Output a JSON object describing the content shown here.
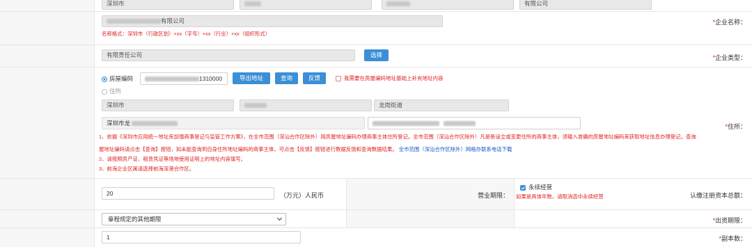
{
  "top_row": {
    "field1": "深圳市",
    "field4": "有限公司"
  },
  "company_name": {
    "label_req": "*",
    "label": "企业名称：",
    "value_suffix": "有限公司",
    "hint": "名称格式：深圳市（行政区划）+xx（字号）+xx（行业）+xx（组织形式）"
  },
  "company_type": {
    "label_req": "*",
    "label": "企业类型：",
    "value": "有限责任公司",
    "select_button": "选择"
  },
  "address": {
    "label_req": "*",
    "label": "住所：",
    "radio_house_code": "房屋编码",
    "house_code_value": "1310000",
    "btn_export": "导出地址",
    "btn_query": "查询",
    "btn_feedback": "反馈",
    "supplement_checkbox": "我需要在房屋编码地址基础上补充地址内容",
    "radio_residence": "住所",
    "city": "深圳市",
    "street": "龙岗街道",
    "full_address_prefix": "深圳市龙",
    "notes": {
      "line1": "1、依据《深圳市应用统一地址库加强商事登记与监管工作方案》，在全市范围（深汕合作区除外）用房屋地址编码办理商事主体住所登记。全市范围（深汕合作区除外）凡是新设立或变更住所的商事主体，须输入准确的房屋地址编码来获取地址信息办理登记。查询",
      "line2_red": "屋地址编码请点击【查询】按钮，如未能查询到自身住所地址编码的商事主体，可点击【反馈】按钮进行数据反馈和查询数据结果。",
      "line2_blue": "全市范围（深汕合作区除外）网格办联系电话下载",
      "line3": "2、请按照房产证、租赁凭证等场地使用证明上的地址内容填写。",
      "line4": "3、前海企业区属请选择前海深港合作区。"
    }
  },
  "capital": {
    "label": "认缴注册资本总额：",
    "value": "20",
    "unit": "（万元）人民币"
  },
  "term": {
    "label": "营业期限：",
    "checkbox": "永续经营",
    "hint": "如果是具体年数，请取消选中永续经营"
  },
  "contribution": {
    "label_req": "*",
    "label": "出资期限：",
    "selected": "章程规定的其他期限"
  },
  "copies": {
    "label_req": "*",
    "label": "副本数：",
    "value": "1"
  },
  "colors": {
    "accent": "#3a8fd6",
    "required": "#e02020",
    "link_blue": "#1a55c9"
  }
}
